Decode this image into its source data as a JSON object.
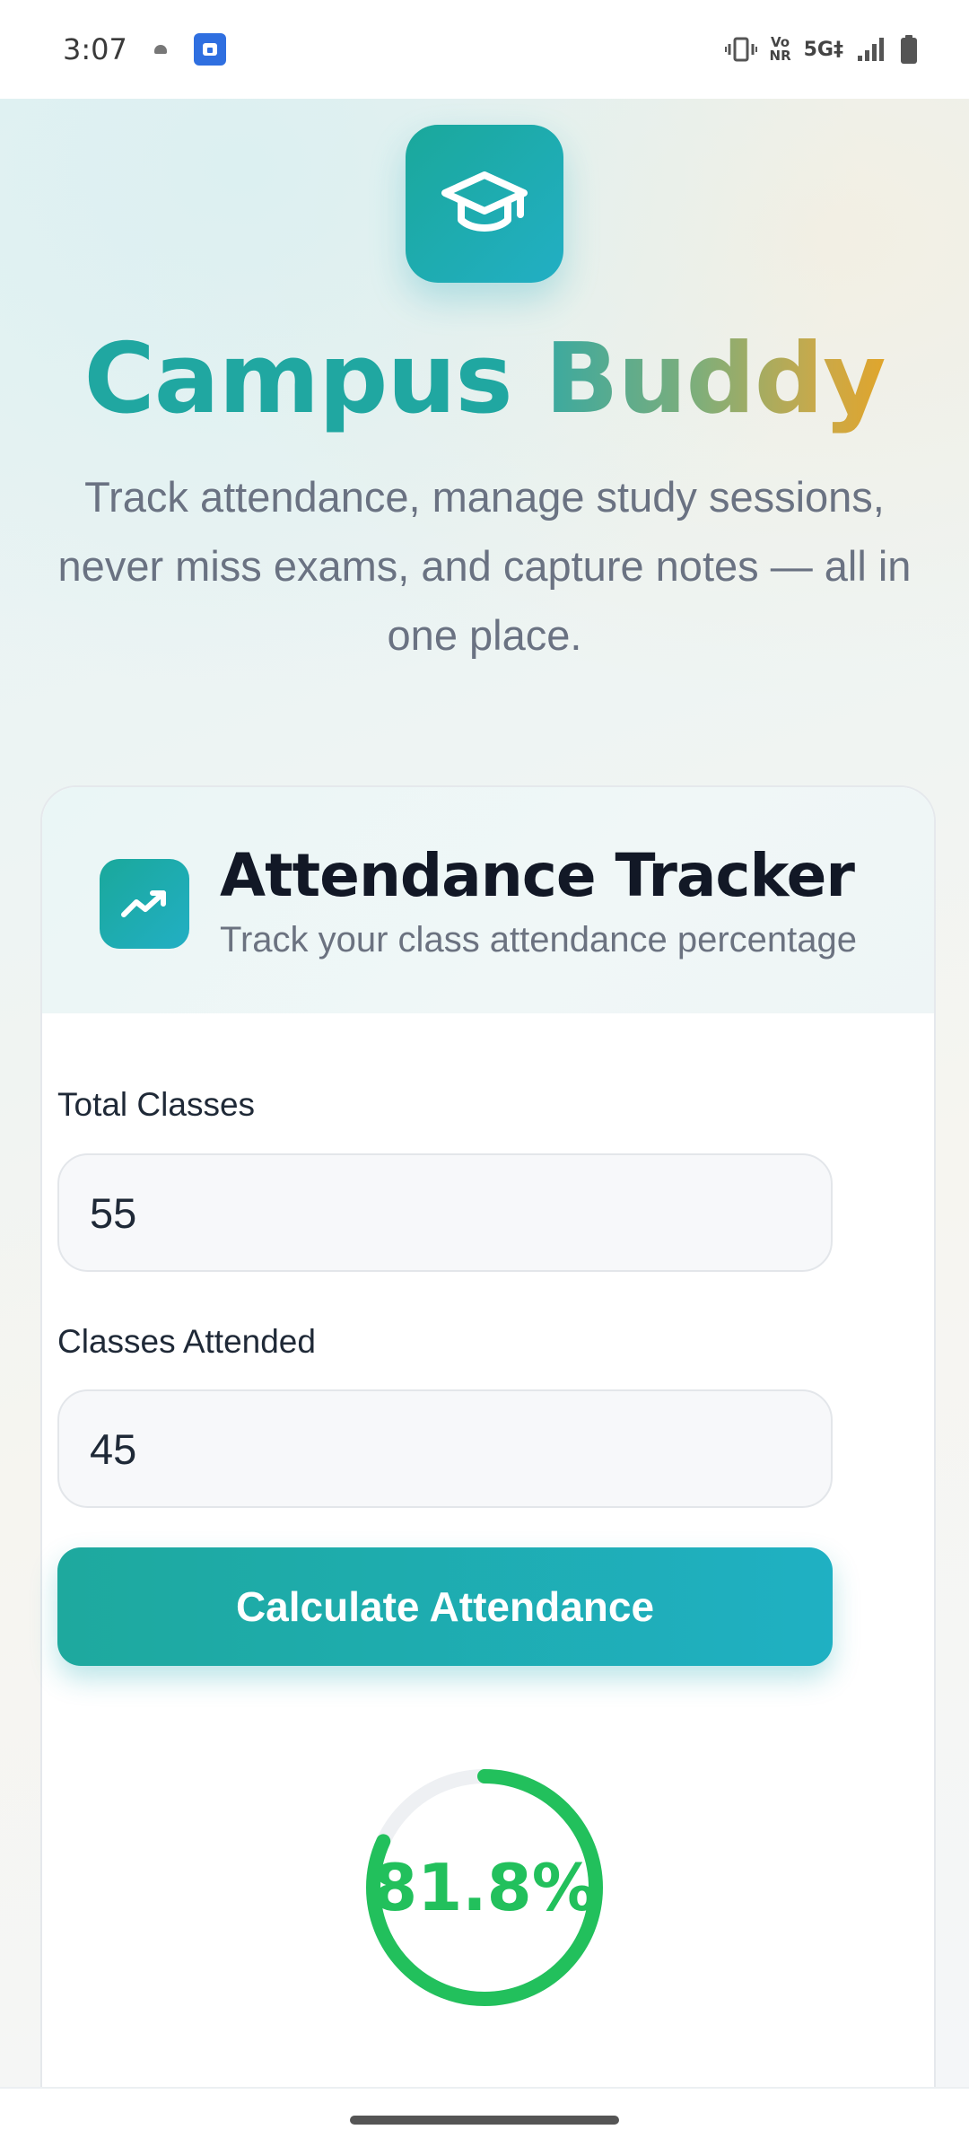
{
  "status_bar": {
    "time": "3:07",
    "network_vo_nr_top": "Vo",
    "network_vo_nr_bottom": "NR",
    "network_5g": "5G‡",
    "icons": [
      "cloud-icon",
      "app-notification-icon",
      "vibrate-icon",
      "signal-icon",
      "battery-icon"
    ]
  },
  "app": {
    "title_part1": "Campus",
    "title_part2": "Buddy",
    "subtitle": "Track attendance, manage study sessions, never miss exams, and capture notes — all in one place.",
    "logo_icon": "graduation-cap-icon"
  },
  "attendance_card": {
    "title": "Attendance Tracker",
    "subtitle": "Track your class attendance percentage",
    "icon": "trending-up-icon",
    "total_label": "Total Classes",
    "total_value": "55",
    "attended_label": "Classes Attended",
    "attended_value": "45",
    "button_label": "Calculate Attendance",
    "result_text": "81.8%",
    "result_fraction": 0.818
  },
  "colors": {
    "accent_teal": "#1ea99e",
    "accent_cyan": "#1fb0c3",
    "gauge_green": "#22c05c",
    "gauge_track": "#eef0f3"
  }
}
